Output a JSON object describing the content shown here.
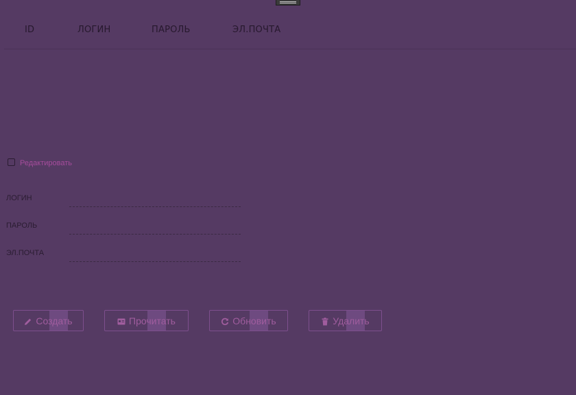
{
  "table": {
    "columns": [
      "ID",
      "ЛОГИН",
      "ПАРОЛЬ",
      "ЭЛ.ПОЧТА"
    ]
  },
  "edit_toggle": {
    "label": "Редактировать",
    "checked": false
  },
  "form": {
    "login_label": "ЛОГИН",
    "login_value": "",
    "password_label": "ПАРОЛЬ",
    "password_value": "",
    "email_label": "ЭЛ.ПОЧТА",
    "email_value": ""
  },
  "actions": {
    "create_label": "Создать",
    "read_label": "Прочитать",
    "update_label": "Обновить",
    "delete_label": "Удалить"
  },
  "colors": {
    "background": "#553a63",
    "accent": "#a64c9c",
    "button_border": "#7e4f8e"
  }
}
